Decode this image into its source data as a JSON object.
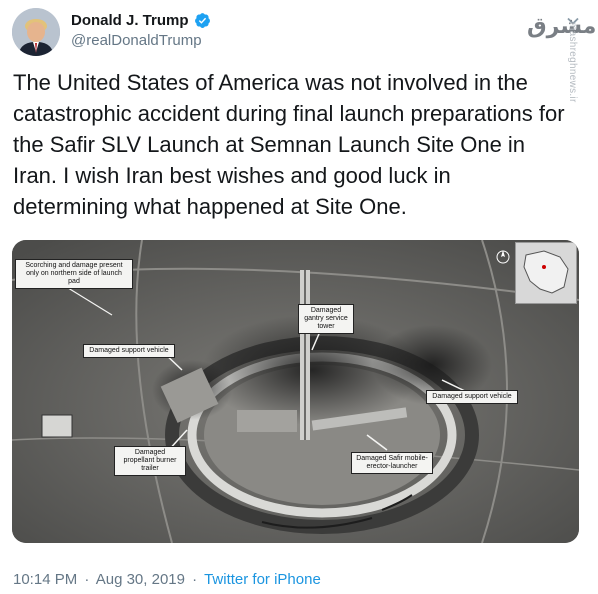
{
  "author": {
    "display_name": "Donald J. Trump",
    "handle": "@realDonaldTrump",
    "verified": true,
    "verified_color": "#1da1f2"
  },
  "watermark": {
    "logo": "مشرق",
    "text": "mashreghnews.ir"
  },
  "tweet": {
    "text": "The United States of America was not involved in the catastrophic accident during final launch preparations for the Safir SLV Launch at Semnan Launch Site One in Iran. I wish Iran best wishes and good luck in determining what happened at Site One."
  },
  "media": {
    "callouts": {
      "scorching": "Scorching and damage present only on northern side of launch pad",
      "gantry": "Damaged gantry service tower",
      "support_left": "Damaged support vehicle",
      "support_right": "Damaged support vehicle",
      "propellant": "Damaged propellant burner trailer",
      "safir": "Damaged Safir mobile-erector-launcher"
    },
    "north_label": "N"
  },
  "footer": {
    "time": "10:14 PM",
    "separator": "·",
    "date": "Aug 30, 2019",
    "source": "Twitter for iPhone"
  },
  "icons": {
    "avatar": "avatar-photo",
    "verified": "verified-badge-icon",
    "menu": "chevron-down-icon"
  },
  "colors": {
    "secondary_text": "#657786",
    "link": "#1b95e0"
  }
}
